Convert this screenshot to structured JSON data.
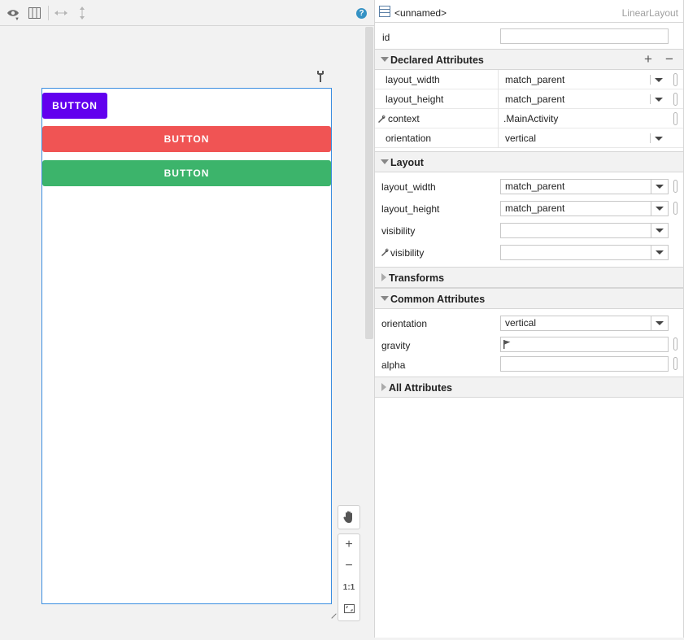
{
  "design_toolbar": {
    "eye_icon": "eye-icon",
    "blueprint_icon": "blueprint-icon",
    "help_label": "?"
  },
  "canvas": {
    "buttons": [
      {
        "label": "BUTTON",
        "color": "#6200ee"
      },
      {
        "label": "BUTTON",
        "color": "#f05454"
      },
      {
        "label": "BUTTON",
        "color": "#3cb46b"
      }
    ],
    "zoom": {
      "plus": "+",
      "minus": "−",
      "one_to_one": "1:1"
    }
  },
  "attributes": {
    "header": {
      "name": "<unnamed>",
      "class": "LinearLayout"
    },
    "id_label": "id",
    "id_value": "",
    "declared": {
      "title": "Declared Attributes",
      "add": "+",
      "remove": "−",
      "rows": [
        {
          "label": "layout_width",
          "value": "match_parent"
        },
        {
          "label": "layout_height",
          "value": "match_parent"
        },
        {
          "label": "context",
          "value": ".MainActivity"
        },
        {
          "label": "orientation",
          "value": "vertical"
        }
      ]
    },
    "layout": {
      "title": "Layout",
      "rows": [
        {
          "label": "layout_width",
          "value": "match_parent"
        },
        {
          "label": "layout_height",
          "value": "match_parent"
        },
        {
          "label": "visibility",
          "value": ""
        },
        {
          "label": "visibility",
          "value": ""
        }
      ]
    },
    "transforms": {
      "title": "Transforms"
    },
    "common": {
      "title": "Common Attributes",
      "orientation_label": "orientation",
      "orientation_value": "vertical",
      "gravity_label": "gravity",
      "alpha_label": "alpha",
      "alpha_value": ""
    },
    "all": {
      "title": "All Attributes"
    }
  },
  "colors": {
    "accent": "#3b8ee0",
    "help": "#3592c4"
  }
}
